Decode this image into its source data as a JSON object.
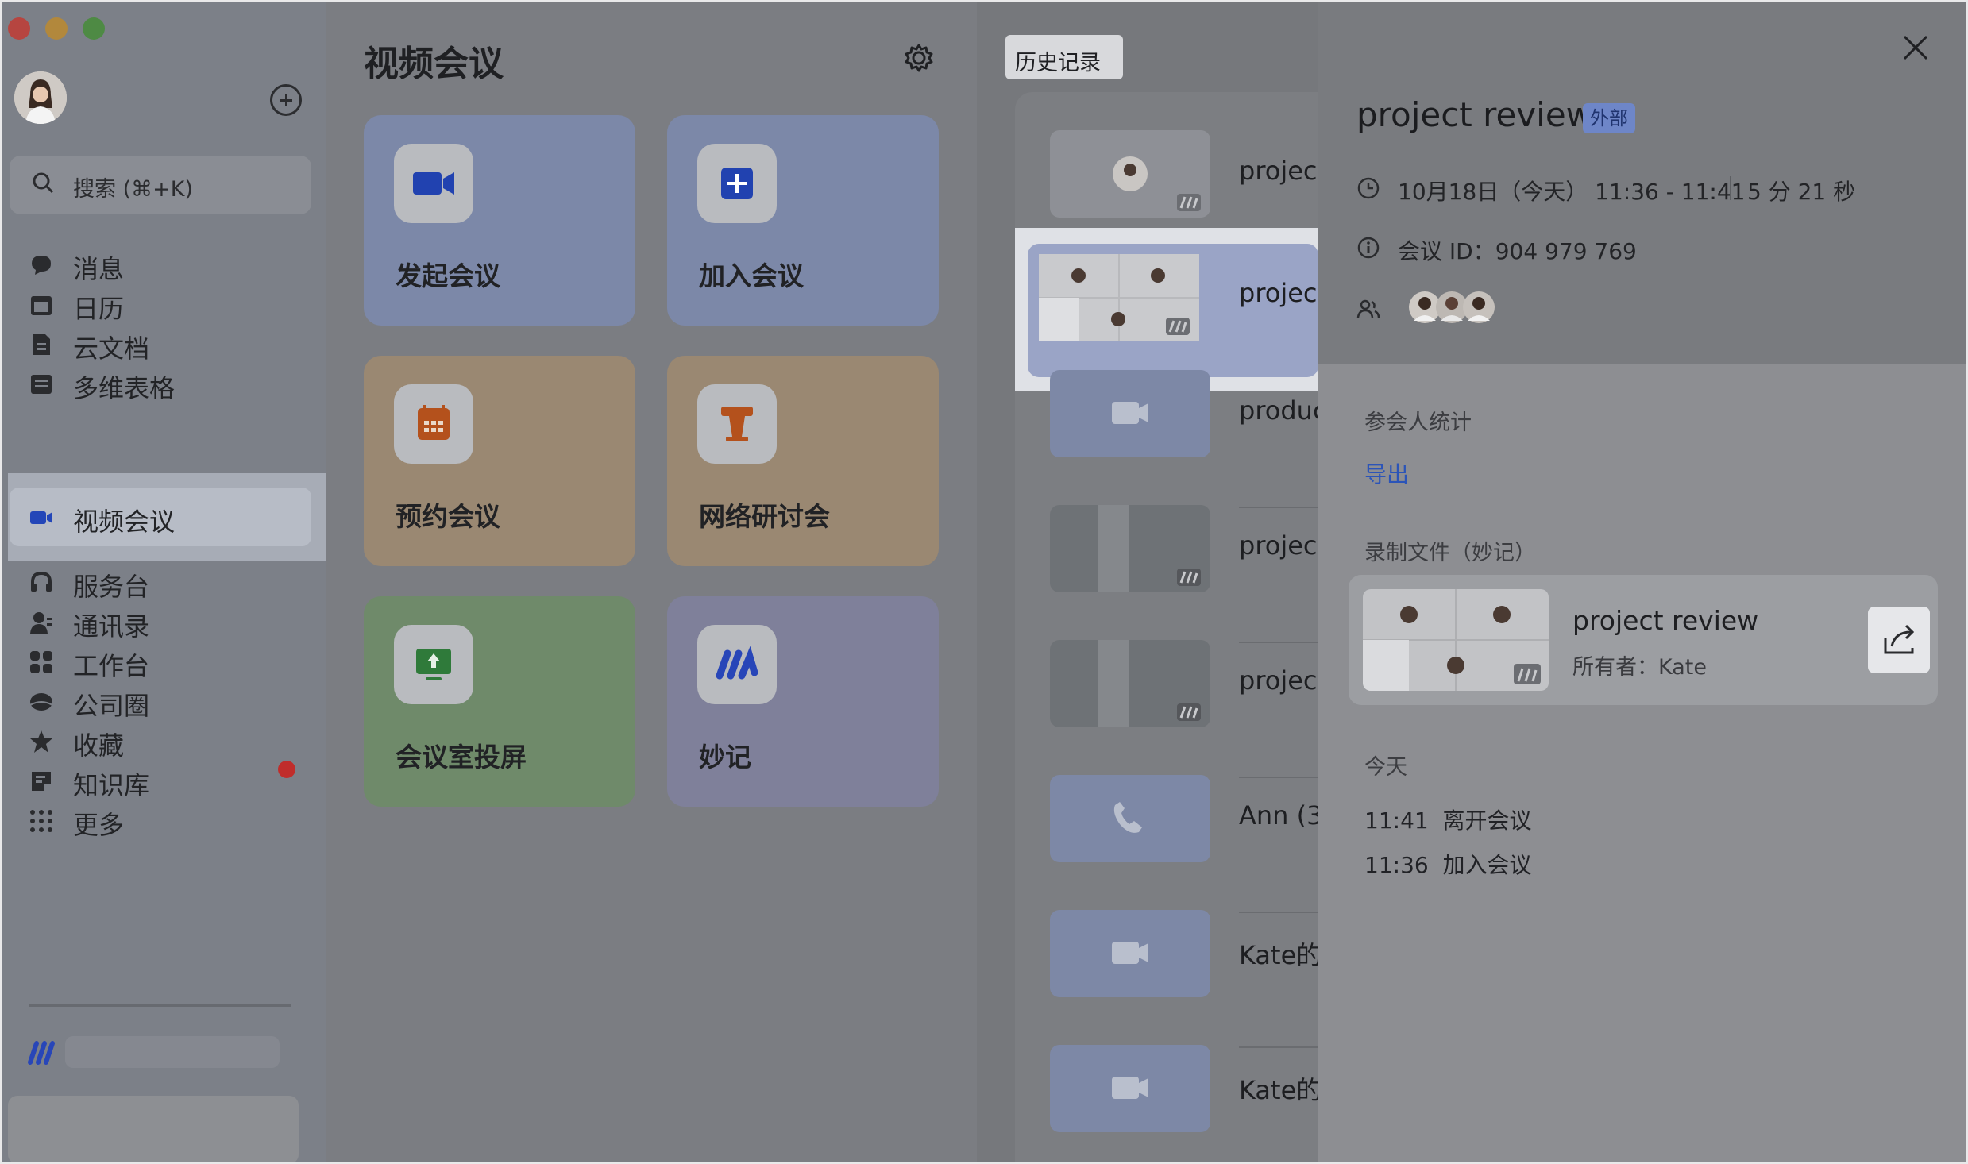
{
  "sidebar": {
    "search_label": "搜索 (⌘+K)",
    "items": [
      {
        "label": "消息",
        "icon": "chat-icon"
      },
      {
        "label": "日历",
        "icon": "calendar-icon"
      },
      {
        "label": "云文档",
        "icon": "docs-icon"
      },
      {
        "label": "多维表格",
        "icon": "table-icon"
      },
      {
        "label": "视频会议",
        "icon": "video-icon"
      },
      {
        "label": "服务台",
        "icon": "helpdesk-icon"
      },
      {
        "label": "通讯录",
        "icon": "contacts-icon"
      },
      {
        "label": "工作台",
        "icon": "workplace-icon"
      },
      {
        "label": "公司圈",
        "icon": "moments-icon"
      },
      {
        "label": "收藏",
        "icon": "star-icon"
      },
      {
        "label": "知识库",
        "icon": "wiki-icon"
      },
      {
        "label": "更多",
        "icon": "more-icon"
      }
    ]
  },
  "main": {
    "title": "视频会议",
    "tiles": [
      {
        "label": "发起会议",
        "icon": "camera-icon",
        "color": "#7c88a8"
      },
      {
        "label": "加入会议",
        "icon": "join-plus-icon",
        "color": "#7c88a8"
      },
      {
        "label": "预约会议",
        "icon": "schedule-icon",
        "color": "#9a8872"
      },
      {
        "label": "网络研讨会",
        "icon": "podium-icon",
        "color": "#9a8872"
      },
      {
        "label": "会议室投屏",
        "icon": "screen-share-icon",
        "color": "#6f8a6a"
      },
      {
        "label": "妙记",
        "icon": "minutes-icon",
        "color": "#7f809a"
      }
    ]
  },
  "history": {
    "tab_label": "历史记录",
    "rows": [
      {
        "title": "project"
      },
      {
        "title": "project"
      },
      {
        "title": "produc"
      },
      {
        "title": "project"
      },
      {
        "title": "project"
      },
      {
        "title": "Ann (3"
      },
      {
        "title": "Kate的"
      },
      {
        "title": "Kate的"
      }
    ]
  },
  "detail": {
    "title": "project review",
    "badge": "外部",
    "time": "10月18日（今天） 11:36 - 11:41",
    "duration": "5 分 21 秒",
    "meeting_id_label": "会议 ID：",
    "meeting_id": "904 979 769",
    "stats_label": "参会人统计",
    "export_label": "导出",
    "recording_label": "录制文件（妙记）",
    "file_name": "project review",
    "file_owner": "所有者：Kate",
    "today_label": "今天",
    "events": [
      {
        "time": "11:41",
        "action": "离开会议"
      },
      {
        "time": "11:36",
        "action": "加入会议"
      }
    ]
  }
}
